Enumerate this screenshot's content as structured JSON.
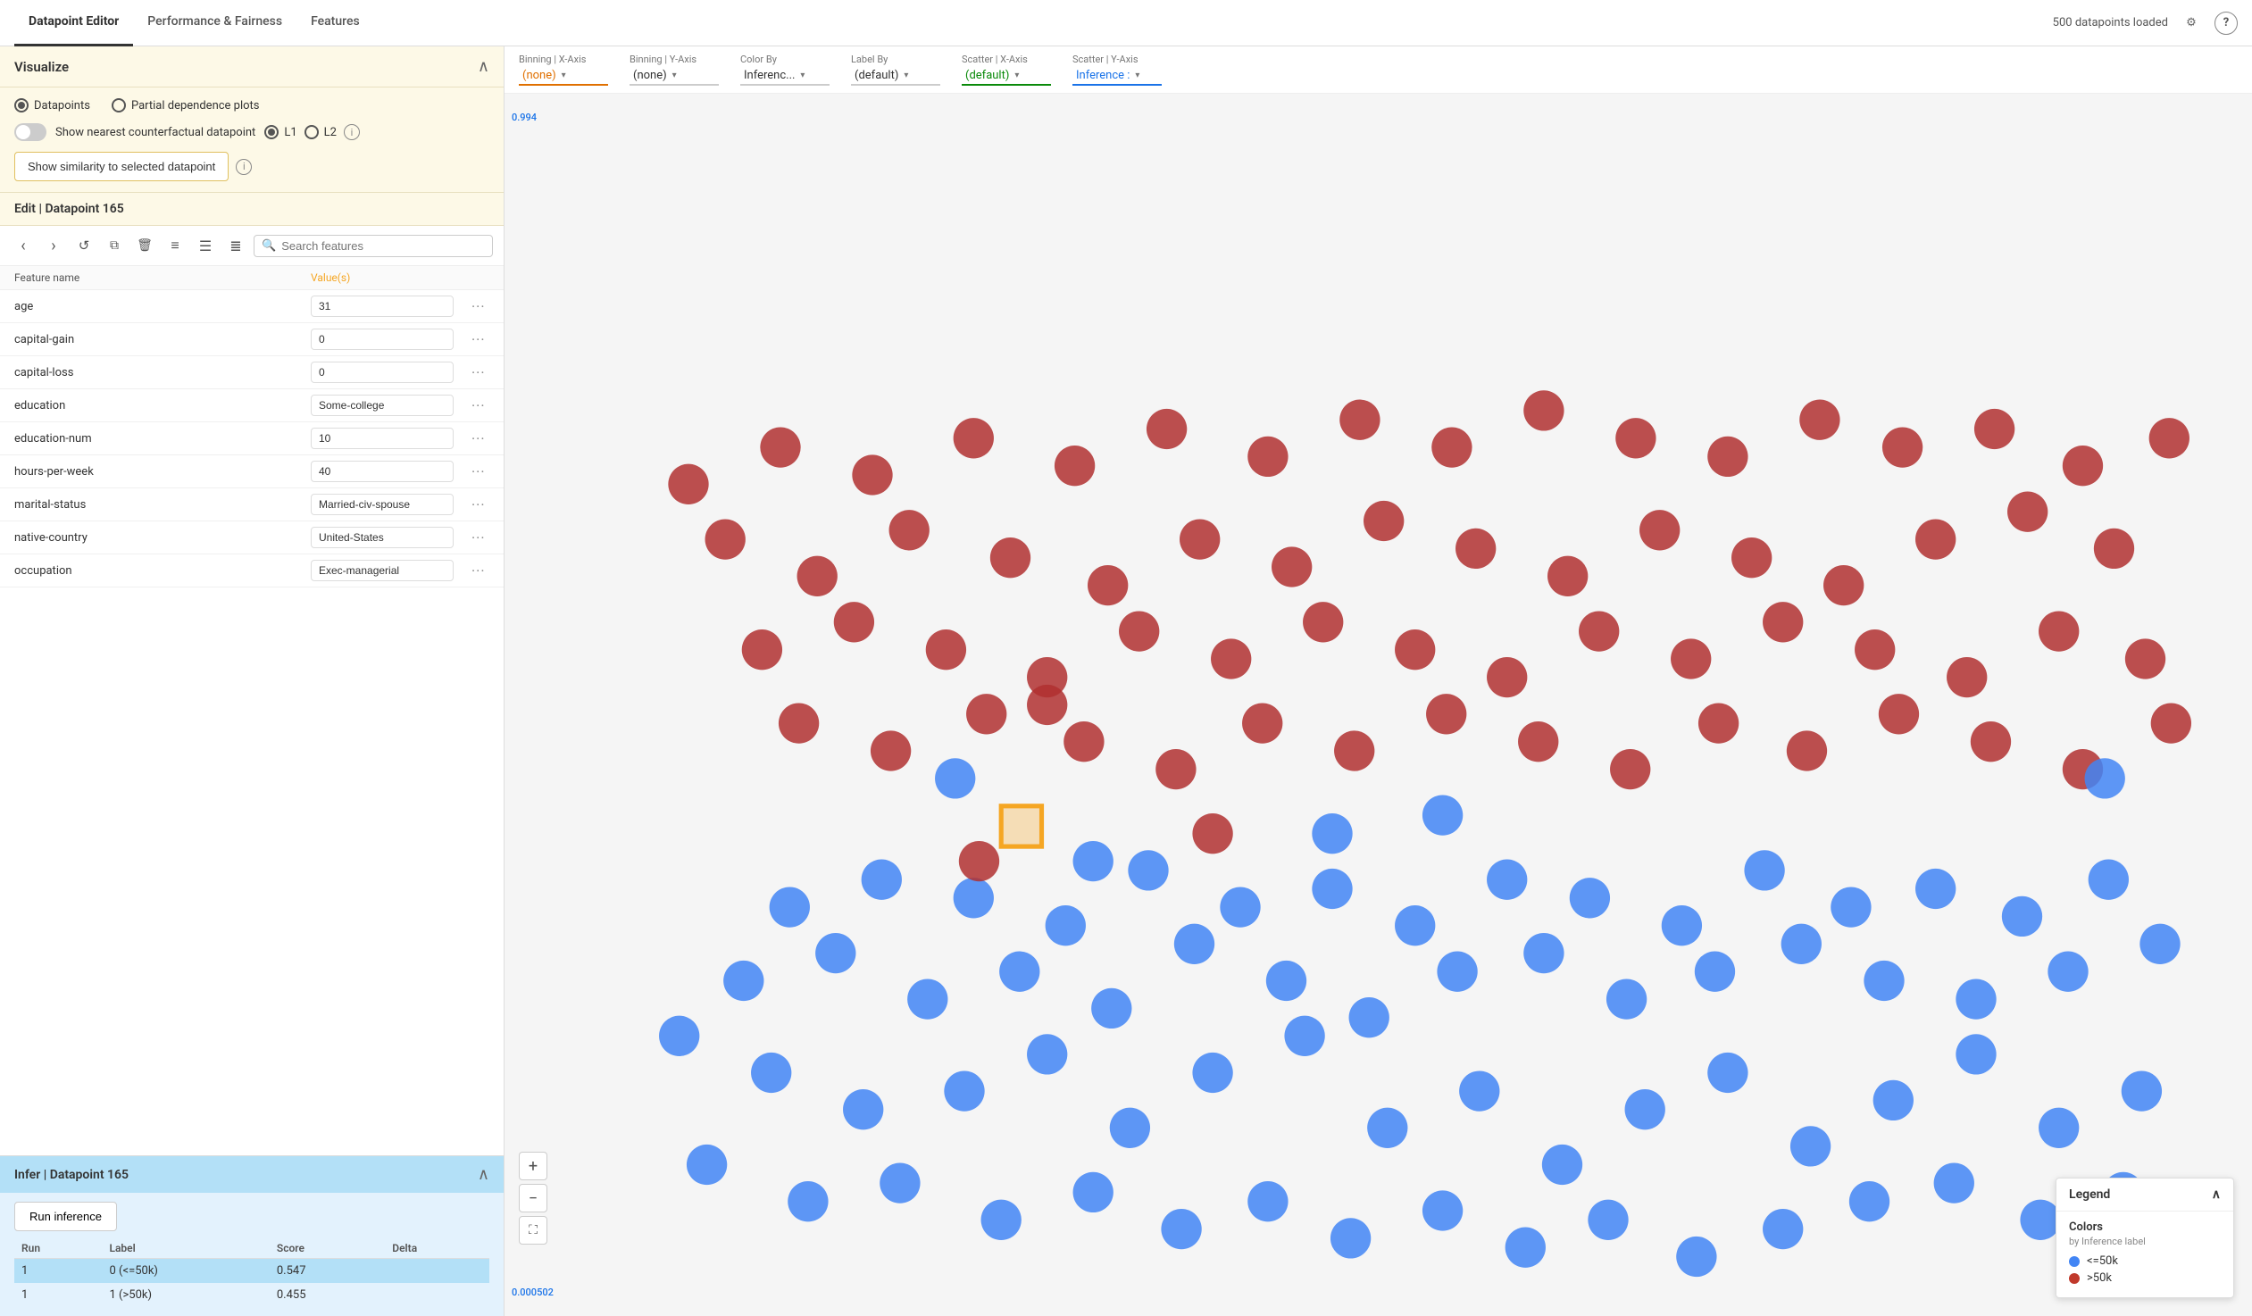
{
  "nav": {
    "tabs": [
      {
        "label": "Datapoint Editor",
        "active": true
      },
      {
        "label": "Performance & Fairness",
        "active": false
      },
      {
        "label": "Features",
        "active": false
      }
    ],
    "status": "500 datapoints loaded"
  },
  "visualize": {
    "title": "Visualize",
    "radio_options": [
      "Datapoints",
      "Partial dependence plots"
    ],
    "toggle_label": "Show nearest counterfactual datapoint",
    "l1_label": "L1",
    "l2_label": "L2",
    "similarity_btn": "Show similarity to selected datapoint"
  },
  "edit": {
    "title": "Edit | Datapoint 165",
    "search_placeholder": "Search features",
    "col_feature": "Feature name",
    "col_value": "Value(s)",
    "features": [
      {
        "name": "age",
        "value": "31"
      },
      {
        "name": "capital-gain",
        "value": "0"
      },
      {
        "name": "capital-loss",
        "value": "0"
      },
      {
        "name": "education",
        "value": "Some-college"
      },
      {
        "name": "education-num",
        "value": "10"
      },
      {
        "name": "hours-per-week",
        "value": "40"
      },
      {
        "name": "marital-status",
        "value": "Married-civ-spouse"
      },
      {
        "name": "native-country",
        "value": "United-States"
      },
      {
        "name": "occupation",
        "value": "Exec-managerial"
      }
    ]
  },
  "infer": {
    "title": "Infer | Datapoint 165",
    "run_btn": "Run inference",
    "cols": [
      "Run",
      "Label",
      "Score",
      "Delta"
    ],
    "rows": [
      {
        "run": "1",
        "label": "0 (<=50k)",
        "score": "0.547",
        "delta": "",
        "highlight": true
      },
      {
        "run": "1",
        "label": "1 (>50k)",
        "score": "0.455",
        "delta": "",
        "highlight": false
      }
    ]
  },
  "toolbar": {
    "binning_x": {
      "label": "Binning | X-Axis",
      "value": "(none)",
      "style": "orange"
    },
    "binning_y": {
      "label": "Binning | Y-Axis",
      "value": "(none)",
      "style": "dark"
    },
    "color_by": {
      "label": "Color By",
      "value": "Inferenc...",
      "style": "dark"
    },
    "label_by": {
      "label": "Label By",
      "value": "(default)",
      "style": "dark"
    },
    "scatter_x": {
      "label": "Scatter | X-Axis",
      "value": "(default)",
      "style": "green"
    },
    "scatter_y": {
      "label": "Scatter | Y-Axis",
      "value": "Inference :",
      "style": "blue"
    }
  },
  "yaxis": {
    "top": "0.994",
    "bottom": "0.000502"
  },
  "legend": {
    "title": "Legend",
    "subtitle": "Colors",
    "sub_label": "by Inference label",
    "items": [
      {
        "label": "<=50k",
        "color": "blue"
      },
      {
        "label": ">50k",
        "color": "red"
      }
    ]
  },
  "zoom": {
    "plus": "+",
    "minus": "−",
    "expand": "⛶"
  },
  "icons": {
    "gear": "⚙",
    "help": "?",
    "prev": "‹",
    "next": "›",
    "history": "↺",
    "copy": "⧉",
    "delete": "🗑",
    "list1": "≡",
    "list2": "☰",
    "list3": "≣",
    "search": "🔍",
    "more": "···",
    "collapse": "∧",
    "chevron": "▾"
  }
}
